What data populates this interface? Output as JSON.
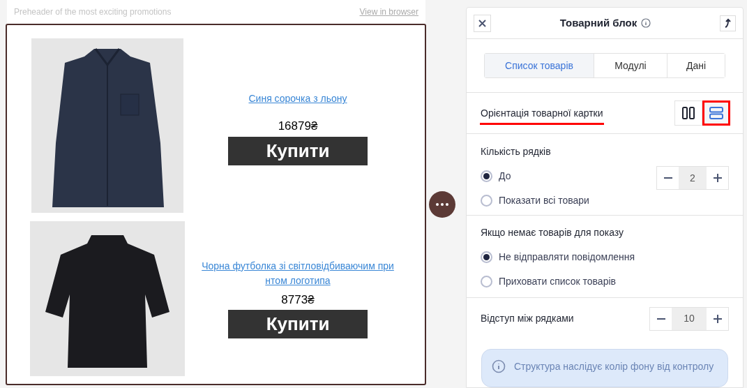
{
  "email": {
    "preheader": "Preheader of the most exciting promotions",
    "view_link": "View in browser",
    "products": [
      {
        "title": "Синя сорочка з льону",
        "price": "16879₴",
        "button": "Купити",
        "kind": "shirt"
      },
      {
        "title": "Чорна футболка зі світловідбиваючим принтом логотипа",
        "price": "8773₴",
        "button": "Купити",
        "kind": "tshirt"
      }
    ]
  },
  "panel": {
    "title": "Товарний блок",
    "tabs": [
      {
        "label": "Список товарів",
        "selected": true
      },
      {
        "label": "Модулі",
        "selected": false
      },
      {
        "label": "Дані",
        "selected": false
      }
    ],
    "orientation": {
      "label": "Орієнтація товарної картки",
      "options": [
        {
          "kind": "columns",
          "selected": false
        },
        {
          "kind": "rows",
          "selected": true
        }
      ]
    },
    "rows_count": {
      "label": "Кількість рядків",
      "options": [
        {
          "label": "До",
          "selected": true
        },
        {
          "label": "Показати всі товари",
          "selected": false
        }
      ],
      "value": "2"
    },
    "no_products": {
      "label": "Якщо немає товарів для показу",
      "options": [
        {
          "label": "Не відправляти повідомлення",
          "selected": true
        },
        {
          "label": "Приховати список товарів",
          "selected": false
        }
      ]
    },
    "row_spacing": {
      "label": "Відступ між рядками",
      "value": "10"
    },
    "info": "Структура наслідує колір фону від контролу"
  }
}
